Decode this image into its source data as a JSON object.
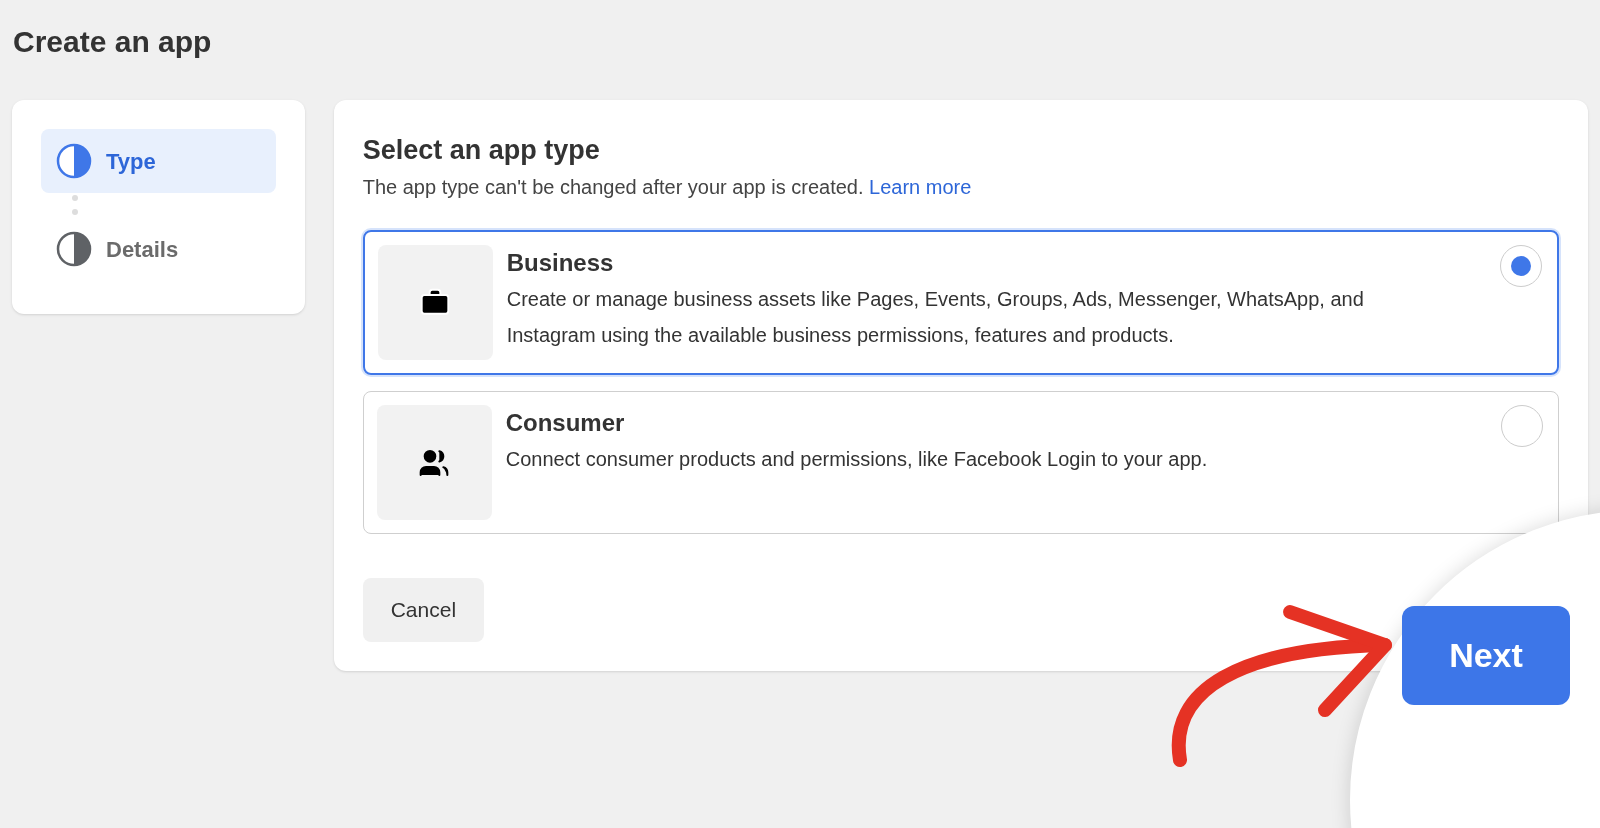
{
  "page_title": "Create an app",
  "steps": [
    {
      "label": "Type",
      "selected": true
    },
    {
      "label": "Details",
      "selected": false
    }
  ],
  "panel": {
    "title": "Select an app type",
    "subtitle": "The app type can't be changed after your app is created.",
    "link": "Learn more"
  },
  "options": [
    {
      "kind": "briefcase",
      "title": "Business",
      "description": "Create or manage business assets like Pages, Events, Groups, Ads, Messenger, WhatsApp, and Instagram using the available business permissions, features and products.",
      "selected": true
    },
    {
      "kind": "people",
      "title": "Consumer",
      "description": "Connect consumer products and permissions, like Facebook Login to your app.",
      "selected": false
    }
  ],
  "buttons": {
    "cancel": "Cancel",
    "next": "Next"
  }
}
